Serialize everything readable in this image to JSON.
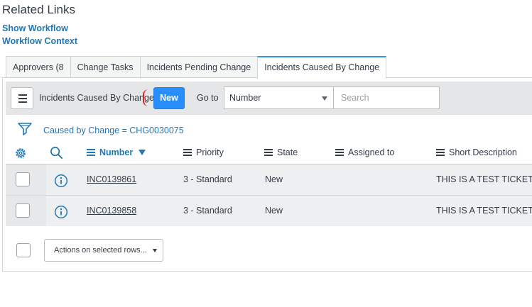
{
  "related_links": {
    "title": "Related Links",
    "links": [
      "Show Workflow",
      "Workflow Context"
    ]
  },
  "tabs": [
    {
      "label": "Approvers (8",
      "active": false
    },
    {
      "label": "Change Tasks",
      "active": false
    },
    {
      "label": "Incidents Pending Change",
      "active": false
    },
    {
      "label": "Incidents Caused By Change",
      "active": true
    }
  ],
  "toolbar": {
    "menu_icon": "hamburger-icon",
    "list_title": "Incidents Caused By Change",
    "new_label": "New",
    "goto_label": "Go to",
    "goto_field": "Number",
    "search_placeholder": "Search"
  },
  "filter": {
    "icon": "funnel-icon",
    "breadcrumb": "Caused by Change = CHG0030075"
  },
  "columns": [
    {
      "label": "Number",
      "sorted": "descending"
    },
    {
      "label": "Priority"
    },
    {
      "label": "State"
    },
    {
      "label": "Assigned to"
    },
    {
      "label": "Short Description"
    }
  ],
  "rows": [
    {
      "number": "INC0139861",
      "priority": "3 - Standard",
      "state": "New",
      "assigned_to": "",
      "short_description": "THIS IS A TEST TICKET, PL"
    },
    {
      "number": "INC0139858",
      "priority": "3 - Standard",
      "state": "New",
      "assigned_to": "",
      "short_description": "THIS IS A TEST TICKET, PL"
    }
  ],
  "footer": {
    "actions_label": "Actions on selected rows..."
  },
  "colors": {
    "accent": "#278efc",
    "link": "#1f78b4",
    "toolbar_bg": "#e4e6e7",
    "row_bg": "#eeeff0",
    "annotation_red": "#e02020"
  }
}
